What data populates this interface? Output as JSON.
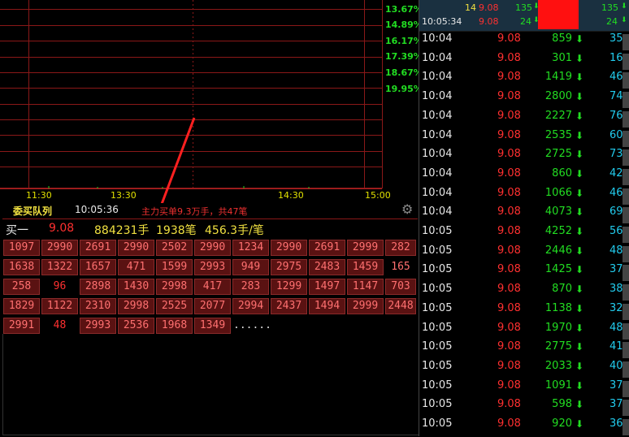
{
  "chart": {
    "pct_labels": [
      "13.67%",
      "14.89%",
      "16.17%",
      "17.39%",
      "18.67%",
      "19.95%"
    ],
    "x_ticks": [
      "11:30",
      "13:30",
      "14:30",
      "15:00"
    ]
  },
  "queue": {
    "title": "委买队列",
    "time": "10:05:36",
    "note": "主力买单9.3万手，共47笔",
    "bid1": {
      "label": "买一",
      "price": "9.08",
      "volume": "884231手",
      "count": "1938笔",
      "avg": "456.3手/笔"
    },
    "rows": [
      [
        "1097",
        "2990",
        "2691",
        "2990",
        "2502",
        "2990",
        "1234",
        "2990",
        "2691",
        "2999",
        "282"
      ],
      [
        "1638",
        "1322",
        "1657",
        "471",
        "1599",
        "2993",
        "949",
        "2975",
        "2483",
        "1459",
        "165"
      ],
      [
        "258",
        "96",
        "2898",
        "1430",
        "2998",
        "417",
        "283",
        "1299",
        "1497",
        "1147",
        "703"
      ],
      [
        "1829",
        "1122",
        "2310",
        "2998",
        "2525",
        "2077",
        "2994",
        "2437",
        "1494",
        "2999",
        "2448"
      ],
      [
        "2991",
        "48",
        "2993",
        "2536",
        "1968",
        "1349",
        "......"
      ]
    ],
    "colors": {
      "cell_bg": "#5a1212",
      "cell_text": "#ff7070",
      "accent_red": "#ff3030"
    }
  },
  "trades": {
    "header": {
      "row1": {
        "left": "14",
        "price": "9.08",
        "vol": "135",
        "right": "135"
      },
      "row2": {
        "time": "10:05:34",
        "price": "9.08",
        "vol": "24",
        "right": "24"
      }
    },
    "rows": [
      {
        "time": "10:04",
        "price": "9.08",
        "vol": "859",
        "num": "35"
      },
      {
        "time": "10:04",
        "price": "9.08",
        "vol": "301",
        "num": "16"
      },
      {
        "time": "10:04",
        "price": "9.08",
        "vol": "1419",
        "num": "46"
      },
      {
        "time": "10:04",
        "price": "9.08",
        "vol": "2800",
        "num": "74"
      },
      {
        "time": "10:04",
        "price": "9.08",
        "vol": "2227",
        "num": "76"
      },
      {
        "time": "10:04",
        "price": "9.08",
        "vol": "2535",
        "num": "60"
      },
      {
        "time": "10:04",
        "price": "9.08",
        "vol": "2725",
        "num": "73"
      },
      {
        "time": "10:04",
        "price": "9.08",
        "vol": "860",
        "num": "42"
      },
      {
        "time": "10:04",
        "price": "9.08",
        "vol": "1066",
        "num": "46"
      },
      {
        "time": "10:04",
        "price": "9.08",
        "vol": "4073",
        "num": "69"
      },
      {
        "time": "10:05",
        "price": "9.08",
        "vol": "4252",
        "num": "56"
      },
      {
        "time": "10:05",
        "price": "9.08",
        "vol": "2446",
        "num": "48"
      },
      {
        "time": "10:05",
        "price": "9.08",
        "vol": "1425",
        "num": "37"
      },
      {
        "time": "10:05",
        "price": "9.08",
        "vol": "870",
        "num": "38"
      },
      {
        "time": "10:05",
        "price": "9.08",
        "vol": "1138",
        "num": "32"
      },
      {
        "time": "10:05",
        "price": "9.08",
        "vol": "1970",
        "num": "48"
      },
      {
        "time": "10:05",
        "price": "9.08",
        "vol": "2775",
        "num": "41"
      },
      {
        "time": "10:05",
        "price": "9.08",
        "vol": "2033",
        "num": "40"
      },
      {
        "time": "10:05",
        "price": "9.08",
        "vol": "1091",
        "num": "37"
      },
      {
        "time": "10:05",
        "price": "9.08",
        "vol": "598",
        "num": "37"
      },
      {
        "time": "10:05",
        "price": "9.08",
        "vol": "920",
        "num": "36"
      }
    ],
    "arrow_glyph": "⬇"
  }
}
